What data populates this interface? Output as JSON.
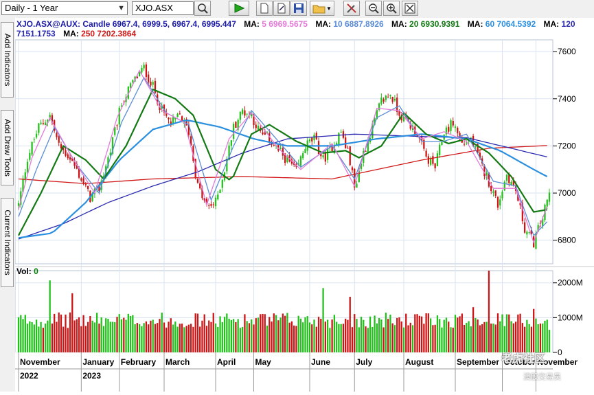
{
  "toolbar": {
    "period": "Daily - 1 Year",
    "symbol": "XJO.ASX",
    "buttons": [
      "search-icon",
      "play-icon",
      "new-doc-icon",
      "edit-doc-icon",
      "save-icon",
      "open-folder-icon",
      "dropdown-icon",
      "tools-icon",
      "zoom-out-icon",
      "zoom-in-icon",
      "zoom-fit-icon"
    ]
  },
  "side_tabs": [
    "Add Indicators",
    "Add Draw Tools",
    "Current Indicators"
  ],
  "legend": {
    "candle": "XJO.ASX@AUX: Candle 6967.4, 6999.5, 6967.4, 6995.447",
    "ma": [
      {
        "label": "MA:",
        "value": "5 6969.5675",
        "color": "#e27ad8"
      },
      {
        "label": "MA:",
        "value": "10 6887.8926",
        "color": "#5a8bd6"
      },
      {
        "label": "MA:",
        "value": "20 6930.9391",
        "color": "#137a13"
      },
      {
        "label": "MA:",
        "value": "60 7064.5392",
        "color": "#2b8fe0"
      },
      {
        "label": "MA:",
        "value": "120 7151.1753",
        "color": "#2a2ab0"
      },
      {
        "label": "MA:",
        "value": "250 7202.3864",
        "color": "#d01818"
      }
    ]
  },
  "volume": {
    "label": "Vol:",
    "value": "0"
  },
  "watermark": {
    "line1": "老虎社区",
    "line2": "澳股交易员"
  },
  "colors": {
    "up": "#22c01a",
    "down": "#cc1414",
    "grid": "#d9e3f2",
    "bg": "#ffffff"
  },
  "chart_data": {
    "type": "candlestick",
    "title": "XJO.ASX@AUX",
    "price_ylim": [
      6700,
      7650
    ],
    "price_ticks": [
      6800,
      7000,
      7200,
      7400,
      7600
    ],
    "volume_ticks": [
      {
        "value": 0,
        "label": "0"
      },
      {
        "value": 1000,
        "label": "1000M"
      },
      {
        "value": 2000,
        "label": "2000M"
      }
    ],
    "volume_ylim": [
      0,
      2350
    ],
    "x_months": [
      "November",
      "January",
      "February",
      "March",
      "April",
      "May",
      "June",
      "July",
      "August",
      "September",
      "October",
      "November"
    ],
    "x_years": [
      "2022",
      "2023"
    ],
    "close_path": [
      {
        "i": 0,
        "v": 6950
      },
      {
        "i": 4,
        "v": 7150
      },
      {
        "i": 9,
        "v": 7280
      },
      {
        "i": 14,
        "v": 7330
      },
      {
        "i": 18,
        "v": 7200
      },
      {
        "i": 23,
        "v": 7150
      },
      {
        "i": 28,
        "v": 7060
      },
      {
        "i": 32,
        "v": 6980
      },
      {
        "i": 36,
        "v": 7020
      },
      {
        "i": 41,
        "v": 7180
      },
      {
        "i": 46,
        "v": 7380
      },
      {
        "i": 51,
        "v": 7470
      },
      {
        "i": 56,
        "v": 7530
      },
      {
        "i": 60,
        "v": 7450
      },
      {
        "i": 64,
        "v": 7350
      },
      {
        "i": 68,
        "v": 7290
      },
      {
        "i": 72,
        "v": 7330
      },
      {
        "i": 76,
        "v": 7260
      },
      {
        "i": 80,
        "v": 7030
      },
      {
        "i": 84,
        "v": 6940
      },
      {
        "i": 88,
        "v": 6960
      },
      {
        "i": 92,
        "v": 7100
      },
      {
        "i": 96,
        "v": 7280
      },
      {
        "i": 100,
        "v": 7350
      },
      {
        "i": 104,
        "v": 7330
      },
      {
        "i": 108,
        "v": 7250
      },
      {
        "i": 112,
        "v": 7230
      },
      {
        "i": 116,
        "v": 7180
      },
      {
        "i": 120,
        "v": 7140
      },
      {
        "i": 124,
        "v": 7090
      },
      {
        "i": 128,
        "v": 7200
      },
      {
        "i": 132,
        "v": 7230
      },
      {
        "i": 136,
        "v": 7140
      },
      {
        "i": 140,
        "v": 7200
      },
      {
        "i": 144,
        "v": 7260
      },
      {
        "i": 148,
        "v": 7140
      },
      {
        "i": 150,
        "v": 7020
      },
      {
        "i": 154,
        "v": 7170
      },
      {
        "i": 158,
        "v": 7280
      },
      {
        "i": 162,
        "v": 7390
      },
      {
        "i": 166,
        "v": 7420
      },
      {
        "i": 170,
        "v": 7340
      },
      {
        "i": 174,
        "v": 7300
      },
      {
        "i": 178,
        "v": 7250
      },
      {
        "i": 182,
        "v": 7150
      },
      {
        "i": 186,
        "v": 7110
      },
      {
        "i": 190,
        "v": 7260
      },
      {
        "i": 194,
        "v": 7300
      },
      {
        "i": 198,
        "v": 7210
      },
      {
        "i": 202,
        "v": 7230
      },
      {
        "i": 206,
        "v": 7130
      },
      {
        "i": 210,
        "v": 7050
      },
      {
        "i": 214,
        "v": 6950
      },
      {
        "i": 218,
        "v": 7080
      },
      {
        "i": 222,
        "v": 7010
      },
      {
        "i": 226,
        "v": 6850
      },
      {
        "i": 230,
        "v": 6790
      },
      {
        "i": 234,
        "v": 6900
      },
      {
        "i": 237,
        "v": 6995
      }
    ],
    "ma_lines": [
      {
        "name": "MA 250",
        "color": "#d01818",
        "pts": [
          {
            "i": 0,
            "v": 7060
          },
          {
            "i": 30,
            "v": 7040
          },
          {
            "i": 60,
            "v": 7060
          },
          {
            "i": 100,
            "v": 7070
          },
          {
            "i": 140,
            "v": 7060
          },
          {
            "i": 180,
            "v": 7140
          },
          {
            "i": 210,
            "v": 7190
          },
          {
            "i": 237,
            "v": 7202
          }
        ]
      },
      {
        "name": "MA 120",
        "color": "#2a2ab0",
        "pts": [
          {
            "i": 0,
            "v": 6805
          },
          {
            "i": 20,
            "v": 6870
          },
          {
            "i": 40,
            "v": 6960
          },
          {
            "i": 60,
            "v": 7030
          },
          {
            "i": 80,
            "v": 7090
          },
          {
            "i": 100,
            "v": 7170
          },
          {
            "i": 120,
            "v": 7230
          },
          {
            "i": 150,
            "v": 7250
          },
          {
            "i": 180,
            "v": 7240
          },
          {
            "i": 200,
            "v": 7235
          },
          {
            "i": 220,
            "v": 7190
          },
          {
            "i": 237,
            "v": 7151
          }
        ]
      },
      {
        "name": "MA 60",
        "color": "#2b8fe0",
        "pts": [
          {
            "i": 0,
            "v": 6810
          },
          {
            "i": 15,
            "v": 6830
          },
          {
            "i": 30,
            "v": 6960
          },
          {
            "i": 45,
            "v": 7140
          },
          {
            "i": 60,
            "v": 7270
          },
          {
            "i": 75,
            "v": 7310
          },
          {
            "i": 90,
            "v": 7280
          },
          {
            "i": 105,
            "v": 7230
          },
          {
            "i": 120,
            "v": 7200
          },
          {
            "i": 140,
            "v": 7200
          },
          {
            "i": 160,
            "v": 7230
          },
          {
            "i": 180,
            "v": 7250
          },
          {
            "i": 200,
            "v": 7230
          },
          {
            "i": 215,
            "v": 7180
          },
          {
            "i": 230,
            "v": 7100
          },
          {
            "i": 237,
            "v": 7065
          }
        ]
      },
      {
        "name": "MA 20",
        "color": "#137a13",
        "pts": [
          {
            "i": 0,
            "v": 6820
          },
          {
            "i": 10,
            "v": 7000
          },
          {
            "i": 20,
            "v": 7200
          },
          {
            "i": 30,
            "v": 7140
          },
          {
            "i": 38,
            "v": 7060
          },
          {
            "i": 48,
            "v": 7200
          },
          {
            "i": 60,
            "v": 7440
          },
          {
            "i": 70,
            "v": 7400
          },
          {
            "i": 78,
            "v": 7330
          },
          {
            "i": 88,
            "v": 7100
          },
          {
            "i": 95,
            "v": 7050
          },
          {
            "i": 104,
            "v": 7250
          },
          {
            "i": 112,
            "v": 7290
          },
          {
            "i": 124,
            "v": 7220
          },
          {
            "i": 136,
            "v": 7170
          },
          {
            "i": 146,
            "v": 7180
          },
          {
            "i": 152,
            "v": 7150
          },
          {
            "i": 162,
            "v": 7200
          },
          {
            "i": 172,
            "v": 7340
          },
          {
            "i": 182,
            "v": 7250
          },
          {
            "i": 192,
            "v": 7210
          },
          {
            "i": 200,
            "v": 7230
          },
          {
            "i": 210,
            "v": 7170
          },
          {
            "i": 220,
            "v": 7070
          },
          {
            "i": 230,
            "v": 6920
          },
          {
            "i": 237,
            "v": 6931
          }
        ]
      },
      {
        "name": "MA 10",
        "color": "#5a8bd6",
        "pts": [
          {
            "i": 0,
            "v": 6900
          },
          {
            "i": 8,
            "v": 7100
          },
          {
            "i": 16,
            "v": 7280
          },
          {
            "i": 26,
            "v": 7120
          },
          {
            "i": 36,
            "v": 7000
          },
          {
            "i": 46,
            "v": 7300
          },
          {
            "i": 56,
            "v": 7490
          },
          {
            "i": 66,
            "v": 7340
          },
          {
            "i": 76,
            "v": 7290
          },
          {
            "i": 86,
            "v": 6970
          },
          {
            "i": 96,
            "v": 7200
          },
          {
            "i": 104,
            "v": 7350
          },
          {
            "i": 116,
            "v": 7220
          },
          {
            "i": 126,
            "v": 7110
          },
          {
            "i": 140,
            "v": 7200
          },
          {
            "i": 150,
            "v": 7060
          },
          {
            "i": 160,
            "v": 7320
          },
          {
            "i": 170,
            "v": 7370
          },
          {
            "i": 180,
            "v": 7220
          },
          {
            "i": 190,
            "v": 7220
          },
          {
            "i": 200,
            "v": 7250
          },
          {
            "i": 212,
            "v": 7050
          },
          {
            "i": 222,
            "v": 7030
          },
          {
            "i": 230,
            "v": 6820
          },
          {
            "i": 237,
            "v": 6888
          }
        ]
      },
      {
        "name": "MA 5",
        "color": "#e27ad8",
        "pts": [
          {
            "i": 0,
            "v": 6930
          },
          {
            "i": 6,
            "v": 7150
          },
          {
            "i": 14,
            "v": 7320
          },
          {
            "i": 24,
            "v": 7150
          },
          {
            "i": 34,
            "v": 7000
          },
          {
            "i": 44,
            "v": 7320
          },
          {
            "i": 54,
            "v": 7520
          },
          {
            "i": 64,
            "v": 7350
          },
          {
            "i": 74,
            "v": 7300
          },
          {
            "i": 84,
            "v": 6950
          },
          {
            "i": 94,
            "v": 7230
          },
          {
            "i": 104,
            "v": 7340
          },
          {
            "i": 116,
            "v": 7190
          },
          {
            "i": 126,
            "v": 7100
          },
          {
            "i": 140,
            "v": 7210
          },
          {
            "i": 150,
            "v": 7030
          },
          {
            "i": 160,
            "v": 7360
          },
          {
            "i": 170,
            "v": 7350
          },
          {
            "i": 180,
            "v": 7230
          },
          {
            "i": 190,
            "v": 7260
          },
          {
            "i": 200,
            "v": 7220
          },
          {
            "i": 212,
            "v": 7020
          },
          {
            "i": 222,
            "v": 7020
          },
          {
            "i": 230,
            "v": 6790
          },
          {
            "i": 237,
            "v": 6970
          }
        ]
      }
    ],
    "volume_spikes": [
      {
        "i": 14,
        "v": 2070
      },
      {
        "i": 24,
        "v": 1700
      },
      {
        "i": 136,
        "v": 1850
      },
      {
        "i": 148,
        "v": 1600
      },
      {
        "i": 203,
        "v": 1300
      },
      {
        "i": 210,
        "v": 2350
      },
      {
        "i": 230,
        "v": 1250
      }
    ]
  }
}
